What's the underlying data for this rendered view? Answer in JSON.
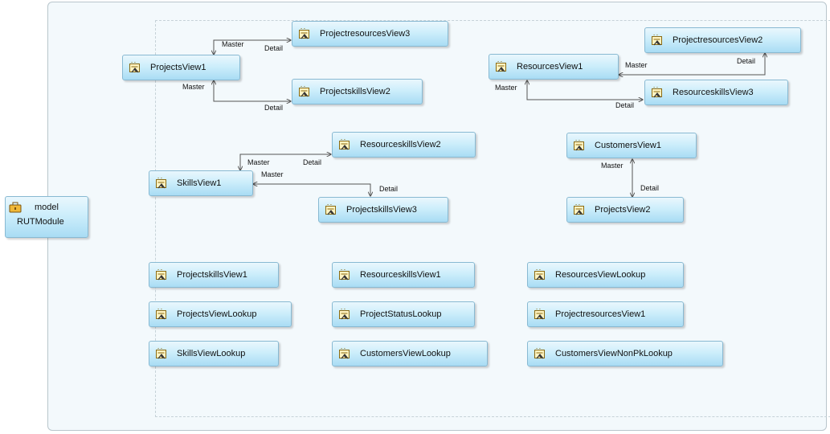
{
  "module": {
    "line1": "model",
    "line2": "RUTModule"
  },
  "nodes": {
    "projects_view1": "ProjectsView1",
    "projectresources_view3": "ProjectresourcesView3",
    "projectskills_view2": "ProjectskillsView2",
    "resources_view1": "ResourcesView1",
    "projectresources_view2": "ProjectresourcesView2",
    "resourceskills_view3": "ResourceskillsView3",
    "skills_view1": "SkillsView1",
    "resourceskills_view2": "ResourceskillsView2",
    "projectskills_view3": "ProjectskillsView3",
    "customers_view1": "CustomersView1",
    "projects_view2": "ProjectsView2",
    "projectskills_view1": "ProjectskillsView1",
    "projects_view_lookup": "ProjectsViewLookup",
    "skills_view_lookup": "SkillsViewLookup",
    "resourceskills_view1": "ResourceskillsView1",
    "project_status_lookup": "ProjectStatusLookup",
    "customers_view_lookup": "CustomersViewLookup",
    "resources_view_lookup": "ResourcesViewLookup",
    "projectresources_view1": "ProjectresourcesView1",
    "customers_view_non_pk_lookup": "CustomersViewNonPkLookup"
  },
  "labels": {
    "master": "Master",
    "detail": "Detail"
  },
  "icons": {
    "view_object": "view-object-icon",
    "module": "application-module-icon"
  },
  "colors": {
    "node_top": "#e9f7fd",
    "node_bottom": "#a9dcf4",
    "node_border": "#88b9d2",
    "link": "#555555"
  }
}
